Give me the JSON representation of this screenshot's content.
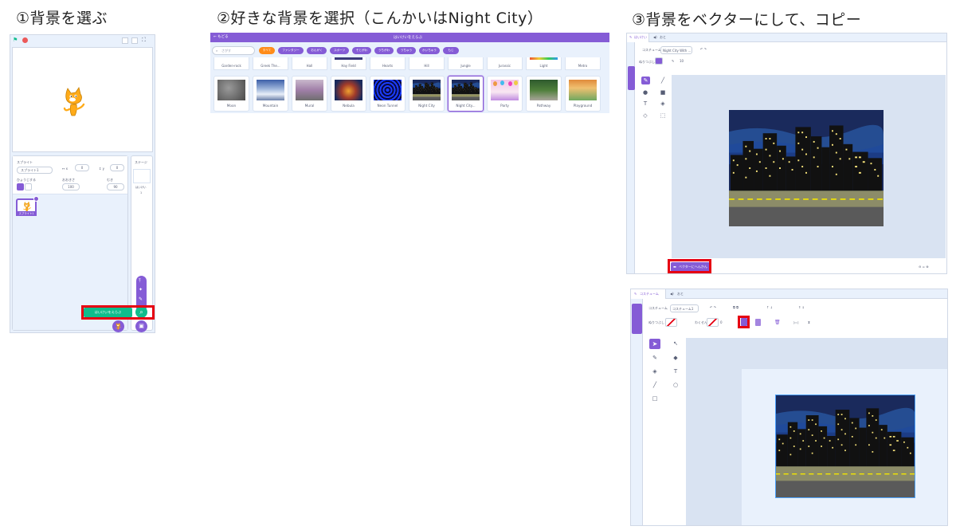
{
  "steps": [
    {
      "title": "①背景を選ぶ"
    },
    {
      "title": "②好きな背景を選択（こんかいはNight City）"
    },
    {
      "title": "③背景をベクターにして、コピー"
    }
  ],
  "editor": {
    "sprite_label": "スプライト",
    "sprite_name": "スプライト1",
    "x_value": "0",
    "y_value": "0",
    "show_label": "ひょうじする",
    "size_label": "おおきさ",
    "size_value": "100",
    "direction_label": "むき",
    "direction_value": "90",
    "sprite_thumb_name": "スプライト1",
    "stage_label": "ステージ",
    "backdrops_label": "はいけい",
    "backdrops_count": "1",
    "choose_backdrop_tooltip": "はいけいをえらぶ"
  },
  "library": {
    "back_label": "もどる",
    "title": "はいけいをえらぶ",
    "search_placeholder": "さがす",
    "categories": [
      "すべて",
      "ファンタジー",
      "おんがく",
      "スポーツ",
      "そとがわ",
      "うちがわ",
      "うちゅう",
      "かいちゅう",
      "もじ"
    ],
    "top_row": [
      "Garden-rock",
      "Greek The...",
      "Hall",
      "Hay Field",
      "Hearts",
      "Hill",
      "Jungle",
      "Jurassic",
      "Light",
      "Metro"
    ],
    "tiles": [
      "Moon",
      "Mountain",
      "Mural",
      "Nebula",
      "Neon Tunnel",
      "Night City",
      "Night City...",
      "Party",
      "Pathway",
      "Playground"
    ]
  },
  "paint1": {
    "tab_costumes": "はいけい",
    "tab_sounds": "おと",
    "costume_label": "コスチューム",
    "costume_name": "Night City With ...",
    "fill_label": "ぬりつぶし",
    "brush_size": "10",
    "convert_button": "ベクターにへんかん"
  },
  "paint2": {
    "tab_costumes": "コスチューム",
    "tab_sounds": "おと",
    "costume_label": "コスチューム",
    "costume_name": "コスチューム1",
    "fill_label": "ぬりつぶし",
    "outline_label": "わくせん",
    "outline_size": "0",
    "copy_caption": "コピー"
  },
  "colors": {
    "scratch_purple": "#855cd6",
    "scratch_green": "#0fbd8c",
    "highlight_red": "#e60012",
    "orange": "#ff8c1a"
  }
}
